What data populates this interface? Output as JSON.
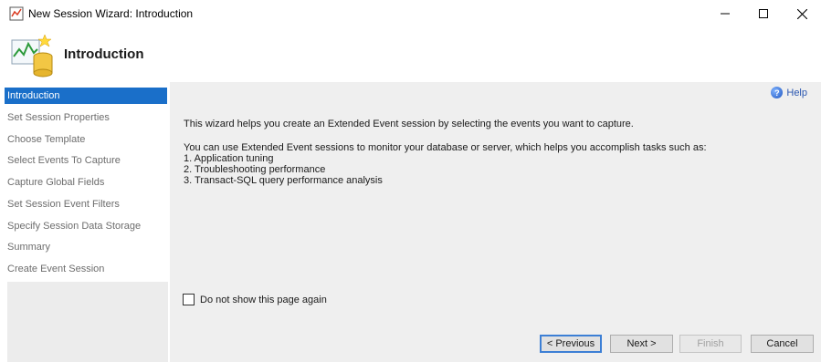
{
  "window": {
    "title": "New Session Wizard: Introduction",
    "controls": [
      "minimize",
      "maximize",
      "close"
    ]
  },
  "header": {
    "title": "Introduction",
    "icon": "wizard-chart-database-icon"
  },
  "sidebar": {
    "steps": [
      {
        "label": "Introduction",
        "active": true
      },
      {
        "label": "Set Session Properties",
        "active": false
      },
      {
        "label": "Choose Template",
        "active": false
      },
      {
        "label": "Select Events To Capture",
        "active": false
      },
      {
        "label": "Capture Global Fields",
        "active": false
      },
      {
        "label": "Set Session Event Filters",
        "active": false
      },
      {
        "label": "Specify Session Data Storage",
        "active": false
      },
      {
        "label": "Summary",
        "active": false
      },
      {
        "label": "Create Event Session",
        "active": false
      }
    ]
  },
  "main": {
    "help_label": "Help",
    "intro": "This wizard helps you create an Extended Event session by selecting the events you want to capture.",
    "description": "You can use Extended Event sessions to monitor your database or server, which helps you accomplish tasks such as:",
    "tasks": [
      "1. Application tuning",
      "2. Troubleshooting performance",
      "3. Transact-SQL query performance analysis"
    ],
    "checkbox": {
      "label": "Do not show this page again",
      "checked": false
    }
  },
  "buttons": {
    "previous": "< Previous",
    "next": "Next >",
    "finish": "Finish",
    "cancel": "Cancel"
  },
  "colors": {
    "active_step_bg": "#1a6fc9",
    "panel_bg": "#efefef",
    "help_link": "#2a56b0"
  }
}
